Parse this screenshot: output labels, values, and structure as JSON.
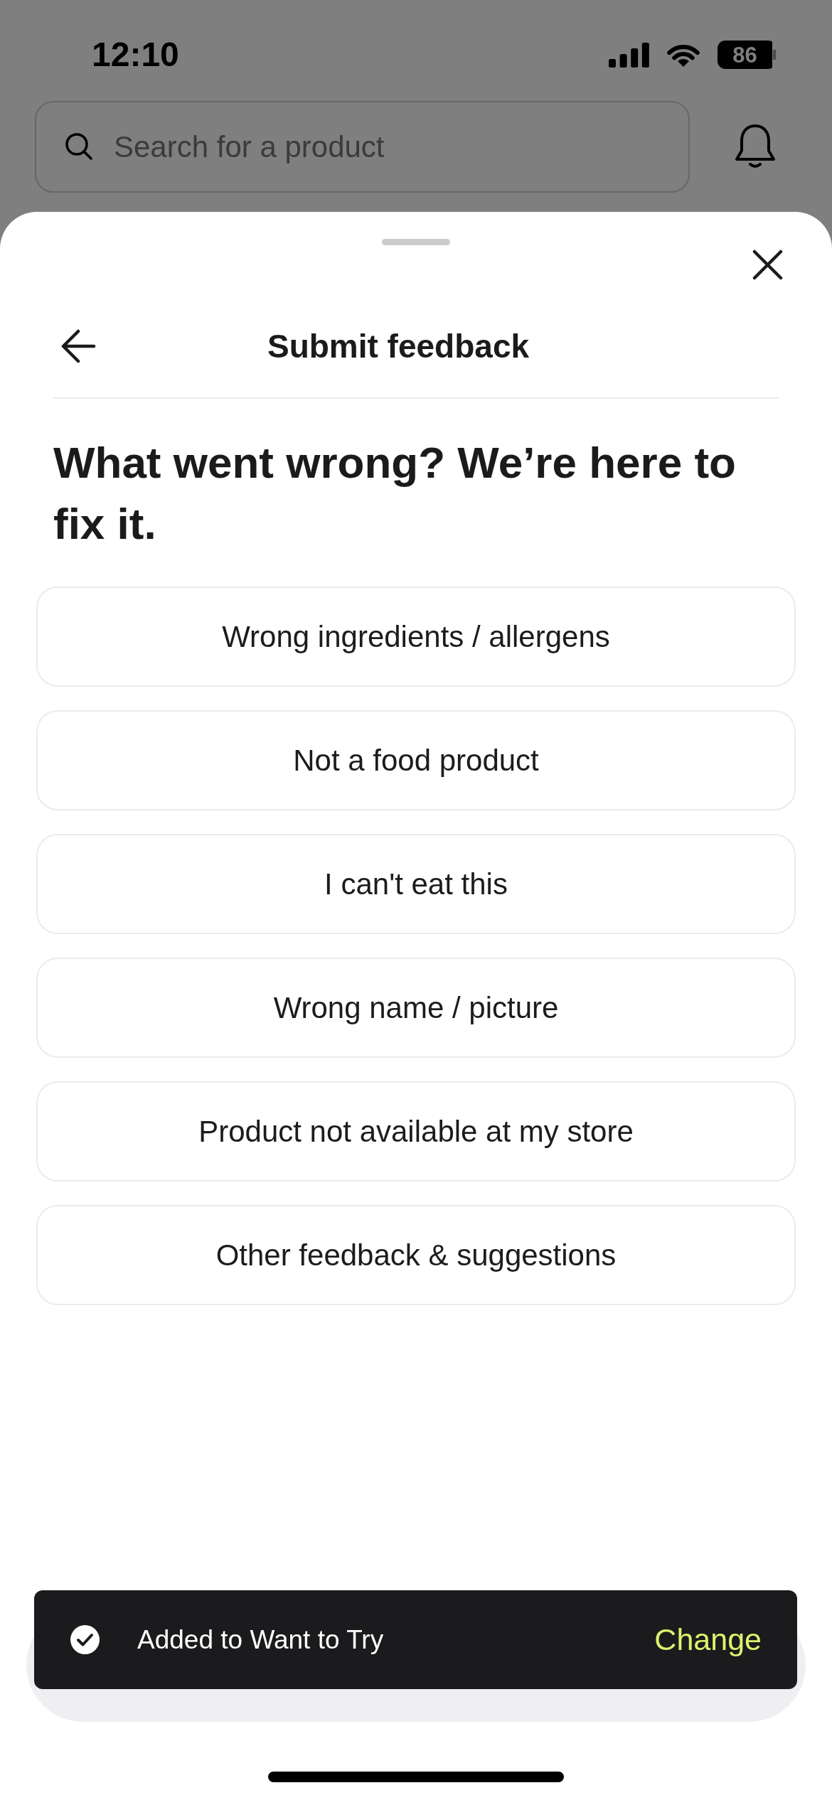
{
  "status_bar": {
    "time": "12:10",
    "battery": "86"
  },
  "search": {
    "placeholder": "Search for a product"
  },
  "sheet": {
    "title": "Submit feedback",
    "heading": "What went wrong? We’re here to fix it.",
    "options": [
      "Wrong ingredients / allergens",
      "Not a food product",
      "I can't eat this",
      "Wrong name / picture",
      "Product not available at my store",
      "Other feedback & suggestions"
    ]
  },
  "toast": {
    "message": "Added to Want to Try",
    "action": "Change"
  }
}
